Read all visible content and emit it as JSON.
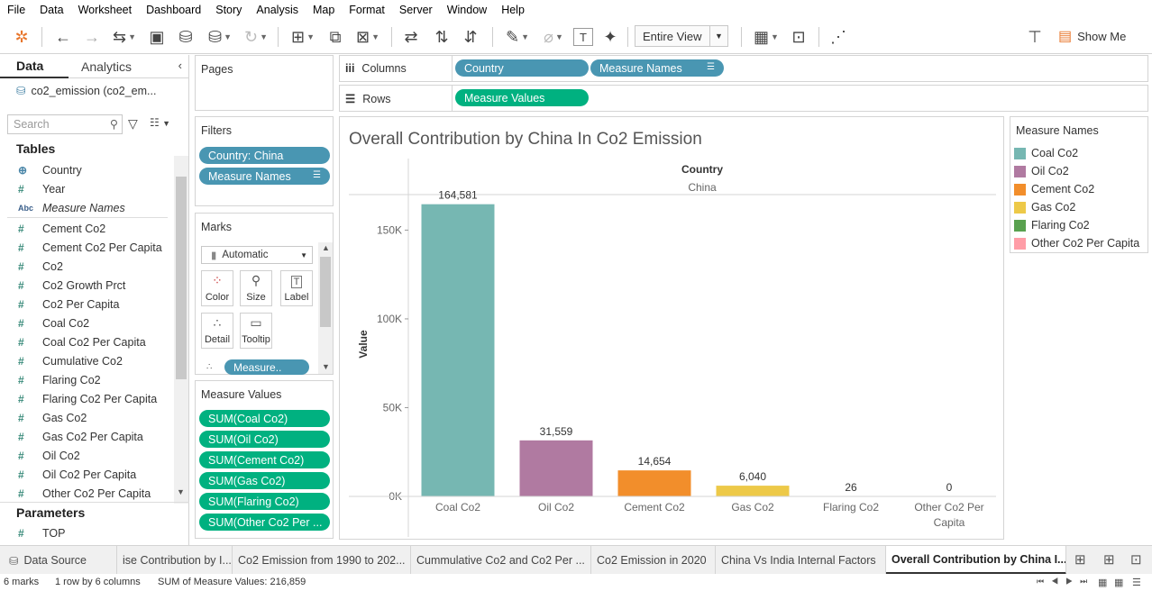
{
  "menu": [
    "File",
    "Data",
    "Worksheet",
    "Dashboard",
    "Story",
    "Analysis",
    "Map",
    "Format",
    "Server",
    "Window",
    "Help"
  ],
  "toolbar": {
    "view_mode": "Entire View",
    "show_me": "Show Me"
  },
  "left_pane": {
    "tab_data": "Data",
    "tab_analytics": "Analytics",
    "datasource": "co2_emission (co2_em...",
    "search_placeholder": "Search",
    "tables_heading": "Tables",
    "fields": [
      {
        "icon": "⊕",
        "name": "Country"
      },
      {
        "icon": "#",
        "name": "Year"
      },
      {
        "icon": "Abc",
        "name": "Measure Names"
      },
      {
        "icon": "#",
        "name": "Cement Co2"
      },
      {
        "icon": "#",
        "name": "Cement Co2 Per Capita"
      },
      {
        "icon": "#",
        "name": "Co2"
      },
      {
        "icon": "#",
        "name": "Co2 Growth Prct"
      },
      {
        "icon": "#",
        "name": "Co2 Per Capita"
      },
      {
        "icon": "#",
        "name": "Coal Co2"
      },
      {
        "icon": "#",
        "name": "Coal Co2 Per Capita"
      },
      {
        "icon": "#",
        "name": "Cumulative Co2"
      },
      {
        "icon": "#",
        "name": "Flaring Co2"
      },
      {
        "icon": "#",
        "name": "Flaring Co2 Per Capita"
      },
      {
        "icon": "#",
        "name": "Gas Co2"
      },
      {
        "icon": "#",
        "name": "Gas Co2 Per Capita"
      },
      {
        "icon": "#",
        "name": "Oil Co2"
      },
      {
        "icon": "#",
        "name": "Oil Co2 Per Capita"
      },
      {
        "icon": "#",
        "name": "Other Co2 Per Capita"
      }
    ],
    "parameters_heading": "Parameters",
    "parameters": [
      {
        "icon": "#",
        "name": "TOP"
      }
    ]
  },
  "cards": {
    "pages": "Pages",
    "filters": "Filters",
    "filter_pills": [
      "Country: China",
      "Measure Names"
    ],
    "marks": "Marks",
    "mark_type": "Automatic",
    "mark_buttons": [
      "Color",
      "Size",
      "Label",
      "Detail",
      "Tooltip"
    ],
    "mark_pill": "Measure..",
    "measure_values": "Measure Values",
    "measure_pills": [
      "SUM(Coal Co2)",
      "SUM(Oil Co2)",
      "SUM(Cement Co2)",
      "SUM(Gas Co2)",
      "SUM(Flaring Co2)",
      "SUM(Other Co2 Per ..."
    ]
  },
  "shelves": {
    "columns_label": "Columns",
    "columns_pills": [
      "Country",
      "Measure Names"
    ],
    "rows_label": "Rows",
    "rows_pills": [
      "Measure Values"
    ]
  },
  "view": {
    "country_header": "Country",
    "country_value": "China"
  },
  "legend": {
    "title": "Measure Names",
    "items": [
      {
        "name": "Coal Co2",
        "color": "#76b7b2"
      },
      {
        "name": "Oil Co2",
        "color": "#b07aa1"
      },
      {
        "name": "Cement Co2",
        "color": "#f28e2b"
      },
      {
        "name": "Gas Co2",
        "color": "#edc948"
      },
      {
        "name": "Flaring Co2",
        "color": "#59a14f"
      },
      {
        "name": "Other Co2 Per Capita",
        "color": "#ff9da7"
      }
    ]
  },
  "chart_data": {
    "type": "bar",
    "title": "Overall Contribution by China In Co2 Emission",
    "ylabel": "Value",
    "xlabel": "",
    "categories": [
      "Coal Co2",
      "Oil Co2",
      "Cement Co2",
      "Gas Co2",
      "Flaring Co2",
      "Other Co2 Per Capita"
    ],
    "values": [
      164581,
      31559,
      14654,
      6040,
      26,
      0
    ],
    "value_labels": [
      "164,581",
      "31,559",
      "14,654",
      "6,040",
      "26",
      "0"
    ],
    "colors": [
      "#76b7b2",
      "#b07aa1",
      "#f28e2b",
      "#edc948",
      "#59a14f",
      "#ff9da7"
    ],
    "yticks": [
      0,
      50000,
      100000,
      150000
    ],
    "ytick_labels": [
      "0K",
      "50K",
      "100K",
      "150K"
    ],
    "ylim": [
      0,
      170000
    ],
    "grid": false,
    "legend": "right"
  },
  "sheet_tabs": [
    {
      "label": "Data Source",
      "active": false
    },
    {
      "label": "ise Contribution by I...",
      "active": false
    },
    {
      "label": "Co2 Emission from 1990 to 202...",
      "active": false
    },
    {
      "label": "Cummulative Co2 and Co2 Per ...",
      "active": false
    },
    {
      "label": "Co2 Emission in 2020",
      "active": false
    },
    {
      "label": "China Vs India Internal Factors",
      "active": false
    },
    {
      "label": "Overall Contribution by China I...",
      "active": true
    }
  ],
  "status": {
    "marks": "6 marks",
    "rows": "1 row by 6 columns",
    "sum": "SUM of Measure Values: 216,859"
  }
}
